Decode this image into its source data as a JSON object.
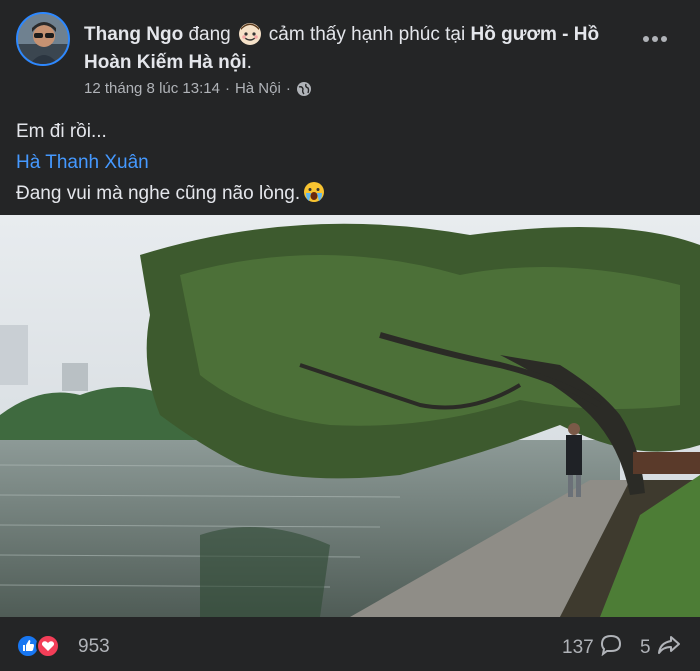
{
  "post": {
    "author": "Thang Ngo",
    "verb": "đang",
    "feeling": "cảm thấy hạnh phúc tại",
    "location_line1": "Hồ gươm -",
    "location_line2": "Hồ Hoàn Kiếm Hà nội",
    "location_end": ".",
    "timestamp": "12 tháng 8 lúc 13:14",
    "dot": "·",
    "city": "Hà Nội",
    "privacy_icon": "globe-icon",
    "line1": "Em đi rồi...",
    "link": "Hà Thanh Xuân",
    "line3": "Đang vui mà nghe cũng não lòng.",
    "emoji": "crying-face-emoji"
  },
  "footer": {
    "reaction_count": "953",
    "comment_count": "137",
    "share_count": "5",
    "icons": [
      "like-icon",
      "love-icon",
      "comment-icon",
      "share-icon"
    ]
  },
  "colors": {
    "background": "#242526",
    "text": "#e4e6eb",
    "secondary": "#b0b3b8",
    "link": "#4599ff",
    "like": "#1877f2",
    "love": "#f33e58"
  }
}
